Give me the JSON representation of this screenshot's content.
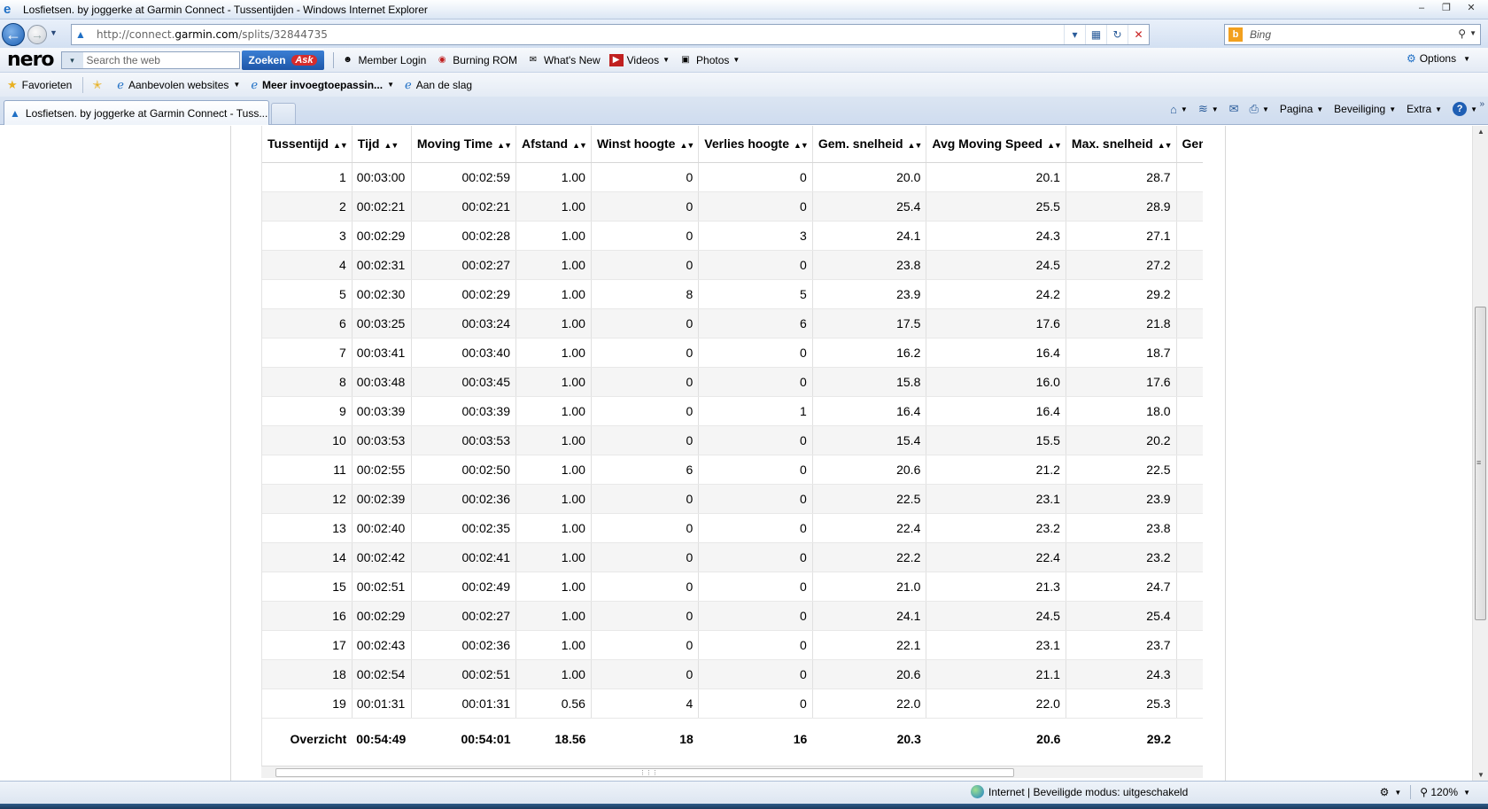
{
  "window": {
    "title": "Losfietsen. by joggerke at Garmin Connect - Tussentijden - Windows Internet Explorer",
    "controls": [
      "‒",
      "❐",
      "✕"
    ]
  },
  "address_bar": {
    "url_prefix": "http://connect.",
    "url_domain": "garmin.com",
    "url_suffix": "/splits/32844735",
    "search_placeholder": "Bing"
  },
  "nero_toolbar": {
    "logo": "nero",
    "search_placeholder": "Search the web",
    "zoeken_label": "Zoeken",
    "ask_label": "Ask",
    "items": [
      {
        "label": "Member Login",
        "icon": "user-icon"
      },
      {
        "label": "Burning ROM",
        "icon": "burn-icon"
      },
      {
        "label": "What's New",
        "icon": "news-icon"
      },
      {
        "label": "Videos",
        "icon": "video-icon"
      },
      {
        "label": "Photos",
        "icon": "photo-icon"
      }
    ],
    "options_label": "Options"
  },
  "favorites_bar": {
    "favorites_label": "Favorieten",
    "items": [
      {
        "label": "Aanbevolen websites",
        "bold": false
      },
      {
        "label": "Meer invoegtoepassin...",
        "bold": true
      },
      {
        "label": "Aan de slag",
        "bold": false
      }
    ]
  },
  "tabs": {
    "active_label": "Losfietsen. by joggerke at Garmin Connect - Tuss..."
  },
  "command_bar": {
    "pagina": "Pagina",
    "beveiliging": "Beveiliging",
    "extra": "Extra"
  },
  "table": {
    "headers": [
      "Tussentijd",
      "Tijd",
      "Moving Time",
      "Afstand",
      "Winst hoogte",
      "Verlies hoogte",
      "Gem. snelheid",
      "Avg Moving Speed",
      "Max. snelheid",
      "Gem"
    ],
    "rows": [
      [
        "1",
        "00:03:00",
        "00:02:59",
        "1.00",
        "0",
        "0",
        "20.0",
        "20.1",
        "28.7"
      ],
      [
        "2",
        "00:02:21",
        "00:02:21",
        "1.00",
        "0",
        "0",
        "25.4",
        "25.5",
        "28.9"
      ],
      [
        "3",
        "00:02:29",
        "00:02:28",
        "1.00",
        "0",
        "3",
        "24.1",
        "24.3",
        "27.1"
      ],
      [
        "4",
        "00:02:31",
        "00:02:27",
        "1.00",
        "0",
        "0",
        "23.8",
        "24.5",
        "27.2"
      ],
      [
        "5",
        "00:02:30",
        "00:02:29",
        "1.00",
        "8",
        "5",
        "23.9",
        "24.2",
        "29.2"
      ],
      [
        "6",
        "00:03:25",
        "00:03:24",
        "1.00",
        "0",
        "6",
        "17.5",
        "17.6",
        "21.8"
      ],
      [
        "7",
        "00:03:41",
        "00:03:40",
        "1.00",
        "0",
        "0",
        "16.2",
        "16.4",
        "18.7"
      ],
      [
        "8",
        "00:03:48",
        "00:03:45",
        "1.00",
        "0",
        "0",
        "15.8",
        "16.0",
        "17.6"
      ],
      [
        "9",
        "00:03:39",
        "00:03:39",
        "1.00",
        "0",
        "1",
        "16.4",
        "16.4",
        "18.0"
      ],
      [
        "10",
        "00:03:53",
        "00:03:53",
        "1.00",
        "0",
        "0",
        "15.4",
        "15.5",
        "20.2"
      ],
      [
        "11",
        "00:02:55",
        "00:02:50",
        "1.00",
        "6",
        "0",
        "20.6",
        "21.2",
        "22.5"
      ],
      [
        "12",
        "00:02:39",
        "00:02:36",
        "1.00",
        "0",
        "0",
        "22.5",
        "23.1",
        "23.9"
      ],
      [
        "13",
        "00:02:40",
        "00:02:35",
        "1.00",
        "0",
        "0",
        "22.4",
        "23.2",
        "23.8"
      ],
      [
        "14",
        "00:02:42",
        "00:02:41",
        "1.00",
        "0",
        "0",
        "22.2",
        "22.4",
        "23.2"
      ],
      [
        "15",
        "00:02:51",
        "00:02:49",
        "1.00",
        "0",
        "0",
        "21.0",
        "21.3",
        "24.7"
      ],
      [
        "16",
        "00:02:29",
        "00:02:27",
        "1.00",
        "0",
        "0",
        "24.1",
        "24.5",
        "25.4"
      ],
      [
        "17",
        "00:02:43",
        "00:02:36",
        "1.00",
        "0",
        "0",
        "22.1",
        "23.1",
        "23.7"
      ],
      [
        "18",
        "00:02:54",
        "00:02:51",
        "1.00",
        "0",
        "0",
        "20.6",
        "21.1",
        "24.3"
      ],
      [
        "19",
        "00:01:31",
        "00:01:31",
        "0.56",
        "4",
        "0",
        "22.0",
        "22.0",
        "25.3"
      ]
    ],
    "summary": [
      "Overzicht",
      "00:54:49",
      "00:54:01",
      "18.56",
      "18",
      "16",
      "20.3",
      "20.6",
      "29.2"
    ]
  },
  "status_bar": {
    "zone": "Internet | Beveiligde modus: uitgeschakeld",
    "zoom": "120%"
  }
}
